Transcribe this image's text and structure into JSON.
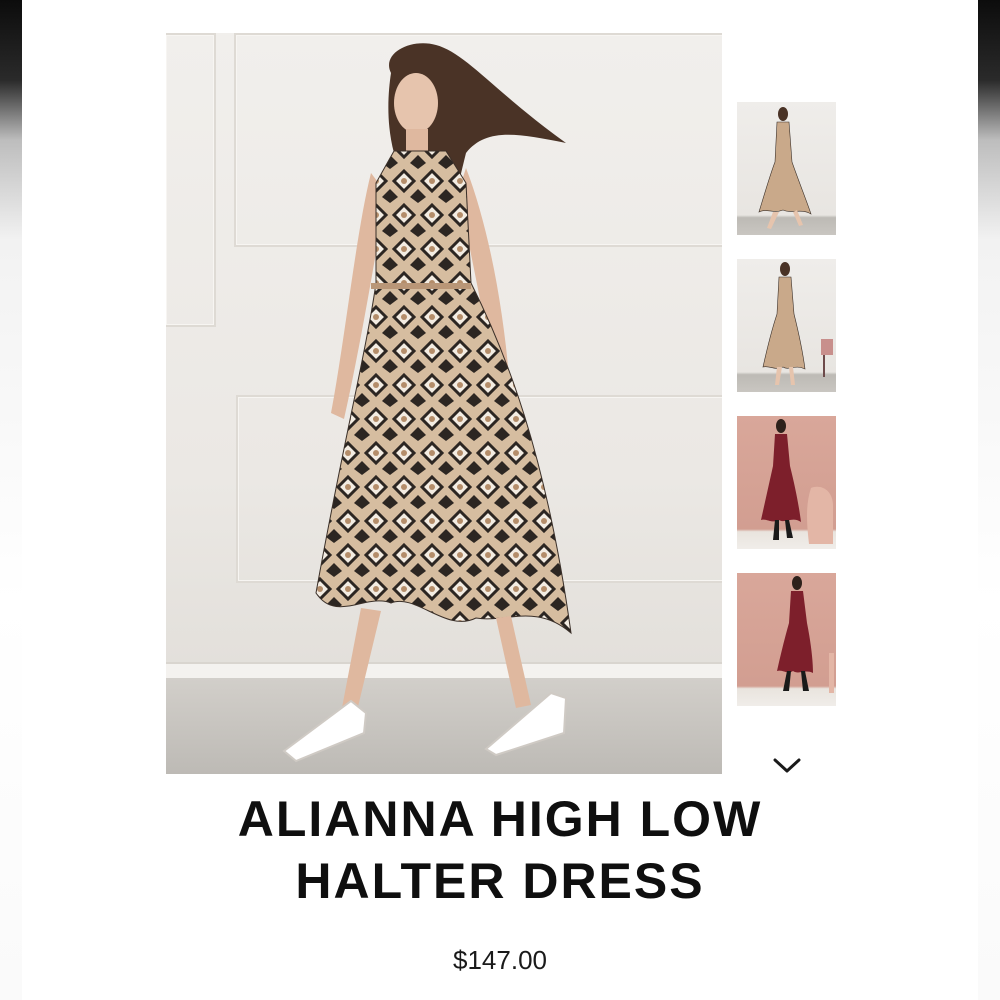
{
  "product": {
    "title_line1": "ALIANNA HIGH LOW",
    "title_line2": "HALTER DRESS",
    "price": "$147.00"
  },
  "gallery": {
    "main_image": "model-snakeskin-print-dress-front",
    "thumbnails": [
      {
        "name": "snakeskin-front-full",
        "color": "#c9a98a"
      },
      {
        "name": "snakeskin-back-full",
        "color": "#c9a98a"
      },
      {
        "name": "burgundy-front-full",
        "color": "#7d1f2b"
      },
      {
        "name": "burgundy-back-full",
        "color": "#7d1f2b"
      }
    ],
    "more_icon": "chevron-down-icon"
  },
  "colors": {
    "text": "#0f0f0f",
    "burgundy": "#7d1f2b",
    "snake_tan": "#c9a98a"
  }
}
